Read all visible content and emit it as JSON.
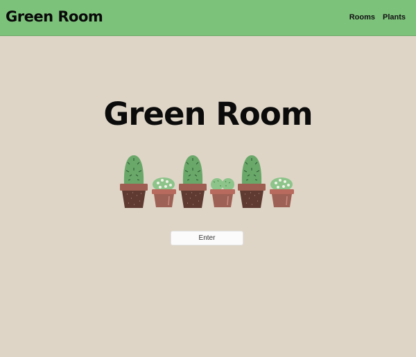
{
  "navbar": {
    "brand": "Green Room",
    "links": [
      "Rooms",
      "Plants"
    ]
  },
  "hero": {
    "title": "Green Room",
    "enter_label": "Enter"
  },
  "illustration": {
    "name": "potted-cacti-row",
    "plants": [
      "tall-cactus",
      "round-cactus-flowers",
      "tall-cactus",
      "bunny-ear-cactus",
      "tall-cactus",
      "round-cactus-flowers"
    ]
  },
  "colors": {
    "navbar": "#7dc27b",
    "background": "#ded5c6",
    "cactus": "#6aa86a",
    "pot_dark": "#5e3a31",
    "pot_light": "#9e6155",
    "button": "#fbfbfc"
  }
}
